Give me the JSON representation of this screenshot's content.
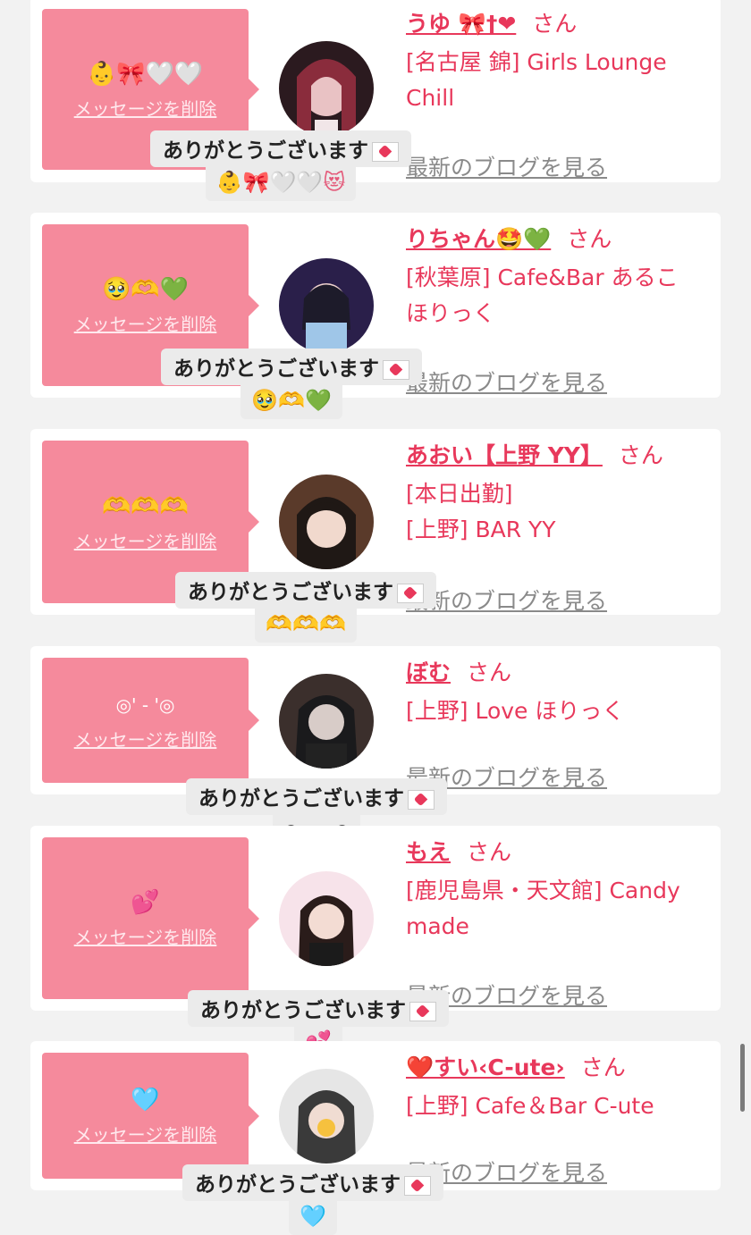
{
  "common": {
    "delete_label": "メッセージを削除",
    "san_label": "さん",
    "blog_label": "最新のブログを見る",
    "reply_text": "ありがとうございます"
  },
  "colors": {
    "accent": "#e8385b",
    "pink_box": "#f58a9c",
    "background": "#f2f2f2"
  },
  "cards": [
    {
      "message": "👶🎀🤍🤍",
      "name": "うゆ 🎀†❤",
      "shop_lines": [
        "[名古屋 錦] Girls Lounge",
        "Chill"
      ],
      "reply_emoji": "👶🎀🤍🤍😻"
    },
    {
      "message": "🥹🫶💚",
      "name": "りちゃん🤩💚",
      "shop_lines": [
        "[秋葉原] Cafe&Bar あるこ",
        "ほりっく"
      ],
      "reply_emoji": "🥹🫶💚"
    },
    {
      "message": "🫶🫶🫶",
      "name": "あおい【上野 YY】",
      "shop_lines": [
        "[本日出勤]",
        "[上野] BAR YY"
      ],
      "reply_emoji": "🫶🫶🫶"
    },
    {
      "message": "◎' - '◎",
      "name": "ぼむ",
      "shop_lines": [
        "[上野] Love ほりっく"
      ],
      "reply_emoji": "◎•‿•◎"
    },
    {
      "message": "💕",
      "name": "もえ",
      "shop_lines": [
        "[鹿児島県・天文館] Candy",
        "made"
      ],
      "reply_emoji": "💕"
    },
    {
      "message": "🩵",
      "name": "❤️すい‹C-ute›",
      "shop_lines": [
        "[上野] Cafe＆Bar C-ute"
      ],
      "reply_emoji": "🩵"
    }
  ]
}
